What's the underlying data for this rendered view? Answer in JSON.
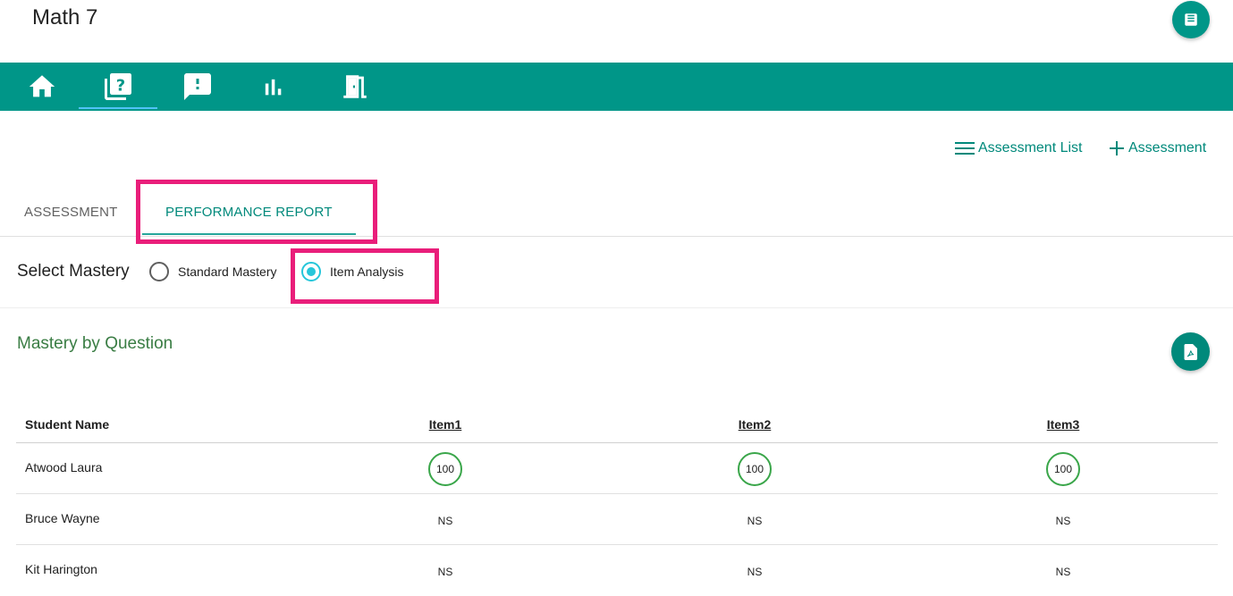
{
  "app": {
    "title": "Math 7"
  },
  "nav": {
    "items": [
      {
        "id": "home",
        "icon": "home-icon"
      },
      {
        "id": "assessments",
        "icon": "quiz-icon",
        "active": true
      },
      {
        "id": "feedback",
        "icon": "feedback-icon"
      },
      {
        "id": "reports",
        "icon": "bar-chart-icon"
      },
      {
        "id": "exit",
        "icon": "exit-door-icon"
      }
    ]
  },
  "toolbar": {
    "assessment_list_label": "Assessment List",
    "add_assessment_label": "Assessment"
  },
  "tabs": [
    {
      "label": "ASSESSMENT",
      "active": false
    },
    {
      "label": "PERFORMANCE REPORT",
      "active": true
    }
  ],
  "mastery": {
    "label": "Select Mastery",
    "options": [
      {
        "label": "Standard Mastery",
        "selected": false
      },
      {
        "label": "Item Analysis",
        "selected": true
      }
    ]
  },
  "section": {
    "title": "Mastery by Question"
  },
  "table": {
    "headers": [
      "Student Name",
      "Item1",
      "Item2",
      "Item3"
    ],
    "rows": [
      {
        "name": "Atwood Laura",
        "scores": [
          "100",
          "100",
          "100"
        ],
        "scored": true
      },
      {
        "name": "Bruce Wayne",
        "scores": [
          "NS",
          "NS",
          "NS"
        ],
        "scored": false
      },
      {
        "name": "Kit Harington",
        "scores": [
          "NS",
          "NS",
          "NS"
        ],
        "scored": false
      }
    ]
  },
  "colors": {
    "primary": "#009688",
    "accent_link": "#00897b",
    "highlight": "#e91e7a",
    "score_ring": "#3aa64a",
    "radio_checked": "#26c6da"
  }
}
